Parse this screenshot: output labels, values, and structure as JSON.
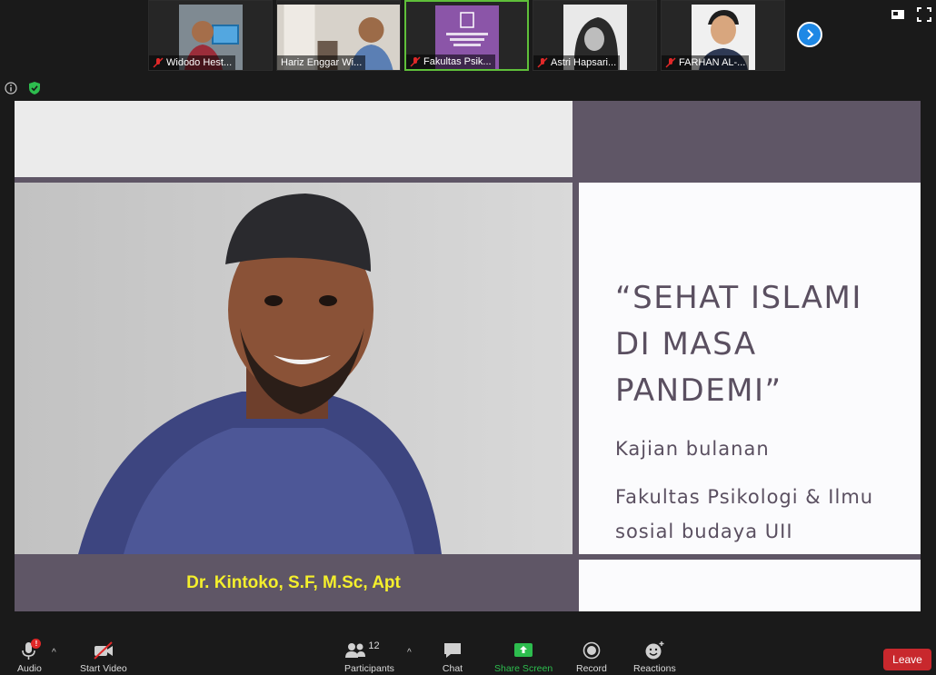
{
  "participants": [
    {
      "name": "Widodo Hest...",
      "muted": true
    },
    {
      "name": "Hariz Enggar Wi...",
      "muted": false
    },
    {
      "name": "Fakultas Psik...",
      "muted": true,
      "active": true
    },
    {
      "name": "Astri Hapsari...",
      "muted": true
    },
    {
      "name": "FARHAN AL-...",
      "muted": true
    }
  ],
  "slide": {
    "title": "“SEHAT ISLAMI DI MASA PANDEMI”",
    "subtitle": "Kajian bulanan",
    "organizer": "Fakultas Psikologi & Ilmu sosial budaya UII",
    "speaker": "Dr. Kintoko, S.F, M.Sc, Apt"
  },
  "toolbar": {
    "audio": "Audio",
    "audio_badge": "!",
    "start_video": "Start Video",
    "participants": "Participants",
    "participants_count": "12",
    "chat": "Chat",
    "share_screen": "Share Screen",
    "record": "Record",
    "reactions": "Reactions",
    "leave": "Leave"
  },
  "colors": {
    "accent_green": "#2dbd4e",
    "leave_red": "#c8282d",
    "slide_purple": "#5f5666",
    "speaker_yellow": "#f4ef2c"
  }
}
